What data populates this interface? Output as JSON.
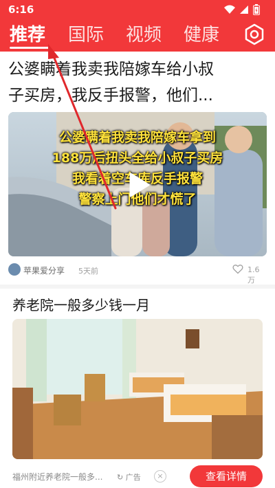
{
  "status_bar": {
    "time": "6:16"
  },
  "tabs": [
    {
      "label": "推荐",
      "active": true
    },
    {
      "label": "国际",
      "active": false
    },
    {
      "label": "视频",
      "active": false
    },
    {
      "label": "健康",
      "active": false
    }
  ],
  "feed": {
    "news_item": {
      "title_line1": "公婆瞒着我卖我陪嫁车给小叔",
      "title_line2": "子买房，我反手报警，他们...",
      "video_caption_lines": [
        "公婆瞒着我卖我陪嫁车拿到",
        "188万后扭头全给小叔子买房",
        "我看着空车库反手报警",
        "警察上门他们才慌了"
      ],
      "author": "苹果爱分享",
      "time_ago": "5天前",
      "likes": "1.6万"
    },
    "ad_item": {
      "title": "养老院一般多少钱一月",
      "description": "福州附近养老院一般多...",
      "badge": "广告",
      "cta_label": "查看详情"
    }
  },
  "colors": {
    "brand_red": "#f2383a",
    "text_dark": "#1a1a1a",
    "text_muted": "#8a8a8a"
  }
}
